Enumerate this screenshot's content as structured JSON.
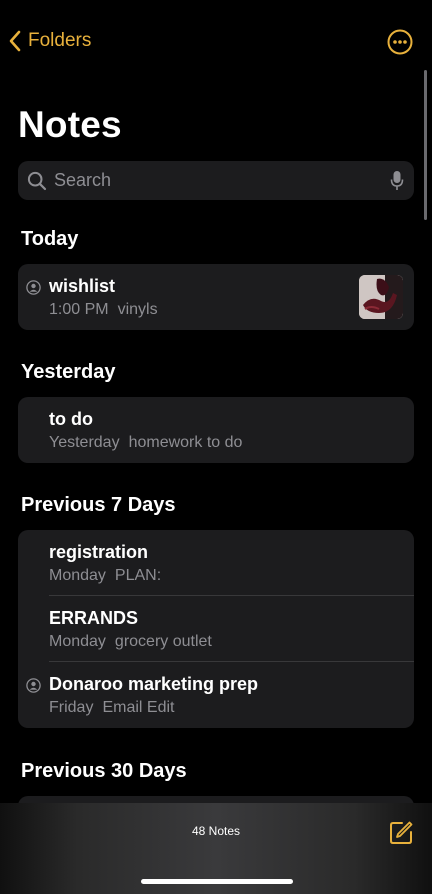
{
  "header": {
    "back_label": "Folders",
    "more_icon": "ellipsis-circle-icon",
    "title": "Notes"
  },
  "search": {
    "placeholder": "Search",
    "value": ""
  },
  "sections": [
    {
      "label": "Today",
      "notes": [
        {
          "title": "wishlist",
          "date": "1:00 PM",
          "preview": "vinyls",
          "shared": true,
          "has_thumbnail": true
        }
      ]
    },
    {
      "label": "Yesterday",
      "notes": [
        {
          "title": "to do",
          "date": "Yesterday",
          "preview": "homework to do",
          "shared": false,
          "has_thumbnail": false
        }
      ]
    },
    {
      "label": "Previous 7 Days",
      "notes": [
        {
          "title": "registration",
          "date": "Monday",
          "preview": "PLAN:",
          "shared": false,
          "has_thumbnail": false
        },
        {
          "title": "ERRANDS",
          "date": "Monday",
          "preview": "grocery outlet",
          "shared": false,
          "has_thumbnail": false
        },
        {
          "title": "Donaroo marketing prep",
          "date": "Friday",
          "preview": "Email Edit",
          "shared": true,
          "has_thumbnail": false
        }
      ]
    },
    {
      "label": "Previous 30 Days",
      "notes": []
    }
  ],
  "toolbar": {
    "count_label": "48 Notes",
    "compose_icon": "compose-icon"
  },
  "colors": {
    "accent": "#e8b13c",
    "background": "#000000",
    "card": "#1c1c1e",
    "secondary_text": "#8e8e93"
  }
}
